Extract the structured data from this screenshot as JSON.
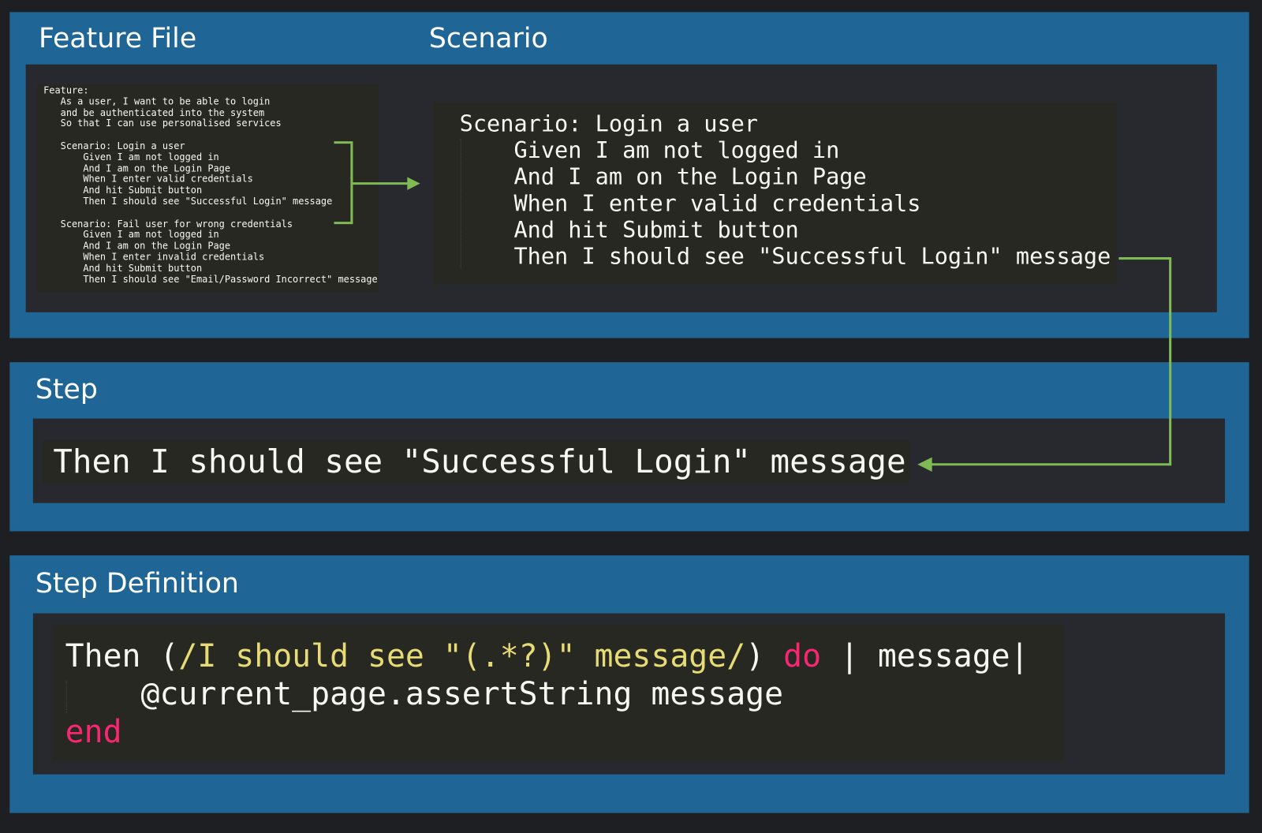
{
  "panels": {
    "feature_title": "Feature File",
    "scenario_title": "Scenario",
    "step_title": "Step",
    "step_definition_title": "Step Definition"
  },
  "feature_file": {
    "lines": [
      "Feature:",
      "   As a user, I want to be able to login",
      "   and be authenticated into the system",
      "   So that I can use personalised services",
      "",
      "   Scenario: Login a user",
      "       Given I am not logged in",
      "       And I am on the Login Page",
      "       When I enter valid credentials",
      "       And hit Submit button",
      "       Then I should see \"Successful Login\" message",
      "",
      "   Scenario: Fail user for wrong credentials",
      "       Given I am not logged in",
      "       And I am on the Login Page",
      "       When I enter invalid credentials",
      "       And hit Submit button",
      "       Then I should see \"Email/Password Incorrect\" message"
    ]
  },
  "scenario": {
    "lines": [
      "Scenario: Login a user",
      "    Given I am not logged in",
      "    And I am on the Login Page",
      "    When I enter valid credentials",
      "    And hit Submit button",
      "    Then I should see \"Successful Login\" message"
    ]
  },
  "step": {
    "text": "Then I should see \"Successful Login\" message"
  },
  "step_definition": {
    "kw_then": "Then ",
    "paren_open": "(",
    "regex": "/I should see \"(.*?)\" message/",
    "paren_close": ")",
    "kw_do": " do",
    "block_params": " | message|",
    "body": "    @current_page.assertString message",
    "kw_end": "end"
  },
  "colors": {
    "panel": "#1f6696",
    "code_bg": "#272822",
    "arrow": "#7fba55",
    "string": "#e6db74",
    "keyword": "#f92672"
  }
}
